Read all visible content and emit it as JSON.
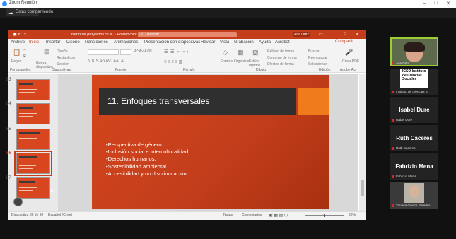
{
  "zoom": {
    "title": "Zoom Reunión",
    "share_banner": "Estás compartiendo"
  },
  "ppt": {
    "title": "Diseño de proyectos SOC - PowerPoint",
    "search_placeholder": "Buscar",
    "user": "Ana Ortiz",
    "tabs": [
      "Archivo",
      "Inicio",
      "Insertar",
      "Diseño",
      "Transiciones",
      "Animaciones",
      "Presentación con diapositivas",
      "Revisar",
      "Vista",
      "Grabación",
      "Ayuda",
      "Acrobat"
    ],
    "share_label": "Compartir",
    "ribbon": {
      "paste": "Pegar",
      "new_slide": "Nueva diapositiva",
      "reuse": "Reutilizar diapositivas",
      "layout": "Diseño",
      "reset": "Restablecer",
      "section": "Sección",
      "font_name": "",
      "font_size": "",
      "shapes": "Formas",
      "arrange": "Organizar",
      "quick_styles": "Estilos rápidos",
      "fill": "Relleno de forma",
      "outline": "Contorno de forma",
      "effects": "Efectos de forma",
      "find": "Buscar",
      "replace": "Reemplazar",
      "select": "Seleccionar",
      "dictate": "Dictar",
      "create_pdf": "Crear PDF",
      "groups": [
        "Portapapeles",
        "Diapositivas",
        "Fuente",
        "Párrafo",
        "Dibujo",
        "Edición",
        "Adobe Acr"
      ]
    },
    "thumbnails": [
      {
        "num": "83"
      },
      {
        "num": "84"
      },
      {
        "num": "85"
      },
      {
        "num": "86"
      },
      {
        "num": "87"
      }
    ],
    "slide": {
      "title": "11. Enfoques transversales",
      "bullets": [
        "•Perspectiva de género.",
        "•Inclusión social e interculturalidad.",
        "•Derechos humanos.",
        "•Sostenibilidad ambiental.",
        "•Accesibilidad y no discriminación."
      ]
    },
    "status": {
      "slide_count": "Diapositiva 86 de 90",
      "language": "Español (Chile)",
      "notes": "Notas",
      "comments": "Comentarios",
      "zoom": "90%"
    }
  },
  "participants": [
    {
      "name": "",
      "caption": "Ana Ortiz"
    },
    {
      "name": "ICSO Instituto de Ciencias Sociales",
      "caption": "Instituto de Ciencias S."
    },
    {
      "name": "Isabel Dure",
      "caption": "Isabel Dure"
    },
    {
      "name": "Ruth Caceres",
      "caption": "Ruth Caceres"
    },
    {
      "name": "Fabrizio Mena",
      "caption": "Fabrizio Mena"
    },
    {
      "name": "",
      "caption": "Ximena Guerra Paredes"
    }
  ],
  "colors": {
    "ppt_accent": "#c43e1c",
    "slide_orange": "#ef7b1c",
    "slide_dark": "#2f2f2f"
  }
}
